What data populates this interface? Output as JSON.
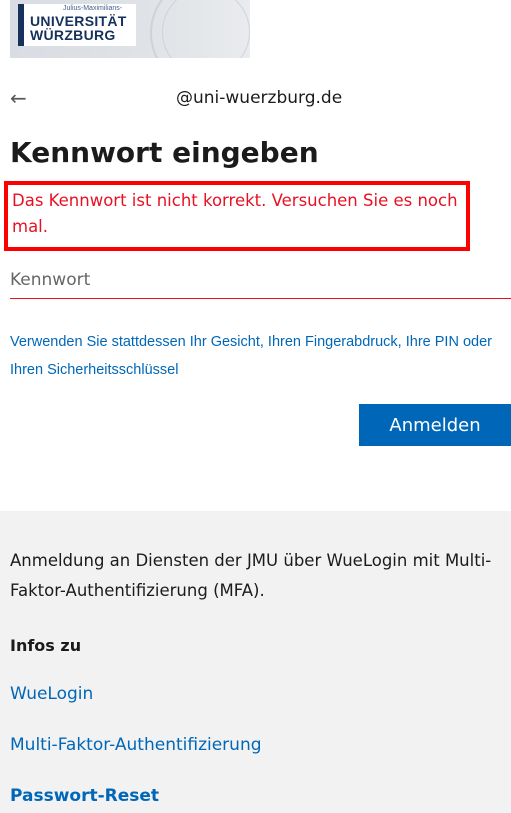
{
  "logo": {
    "small_text": "Julius-Maximilians-",
    "line1": "UNIVERSITÄT",
    "line2": "WÜRZBURG"
  },
  "signin": {
    "back_icon": "back-arrow-icon",
    "identity": "@uni-wuerzburg.de",
    "title": "Kennwort eingeben",
    "error": "Das Kennwort ist nicht korrekt. Versuchen Sie es noch mal.",
    "password_placeholder": "Kennwort",
    "password_value": "",
    "alt_signin_link": "Verwenden Sie stattdessen Ihr Gesicht, Ihren Fingerabdruck, Ihre PIN oder Ihren Sicherheitsschlüssel",
    "submit_label": "Anmelden"
  },
  "footer": {
    "description": "Anmeldung an Diensten der JMU über WueLogin mit Multi-Faktor-Authentifizierung (MFA).",
    "infos_heading": "Infos zu",
    "links": [
      "WueLogin",
      "Multi-Faktor-Authentifizierung",
      "Passwort-Reset"
    ]
  },
  "colors": {
    "accent": "#0067b8",
    "error": "#e81123",
    "highlight_box": "#ff0000",
    "footer_bg": "#f2f2f2",
    "brand": "#16325c"
  }
}
